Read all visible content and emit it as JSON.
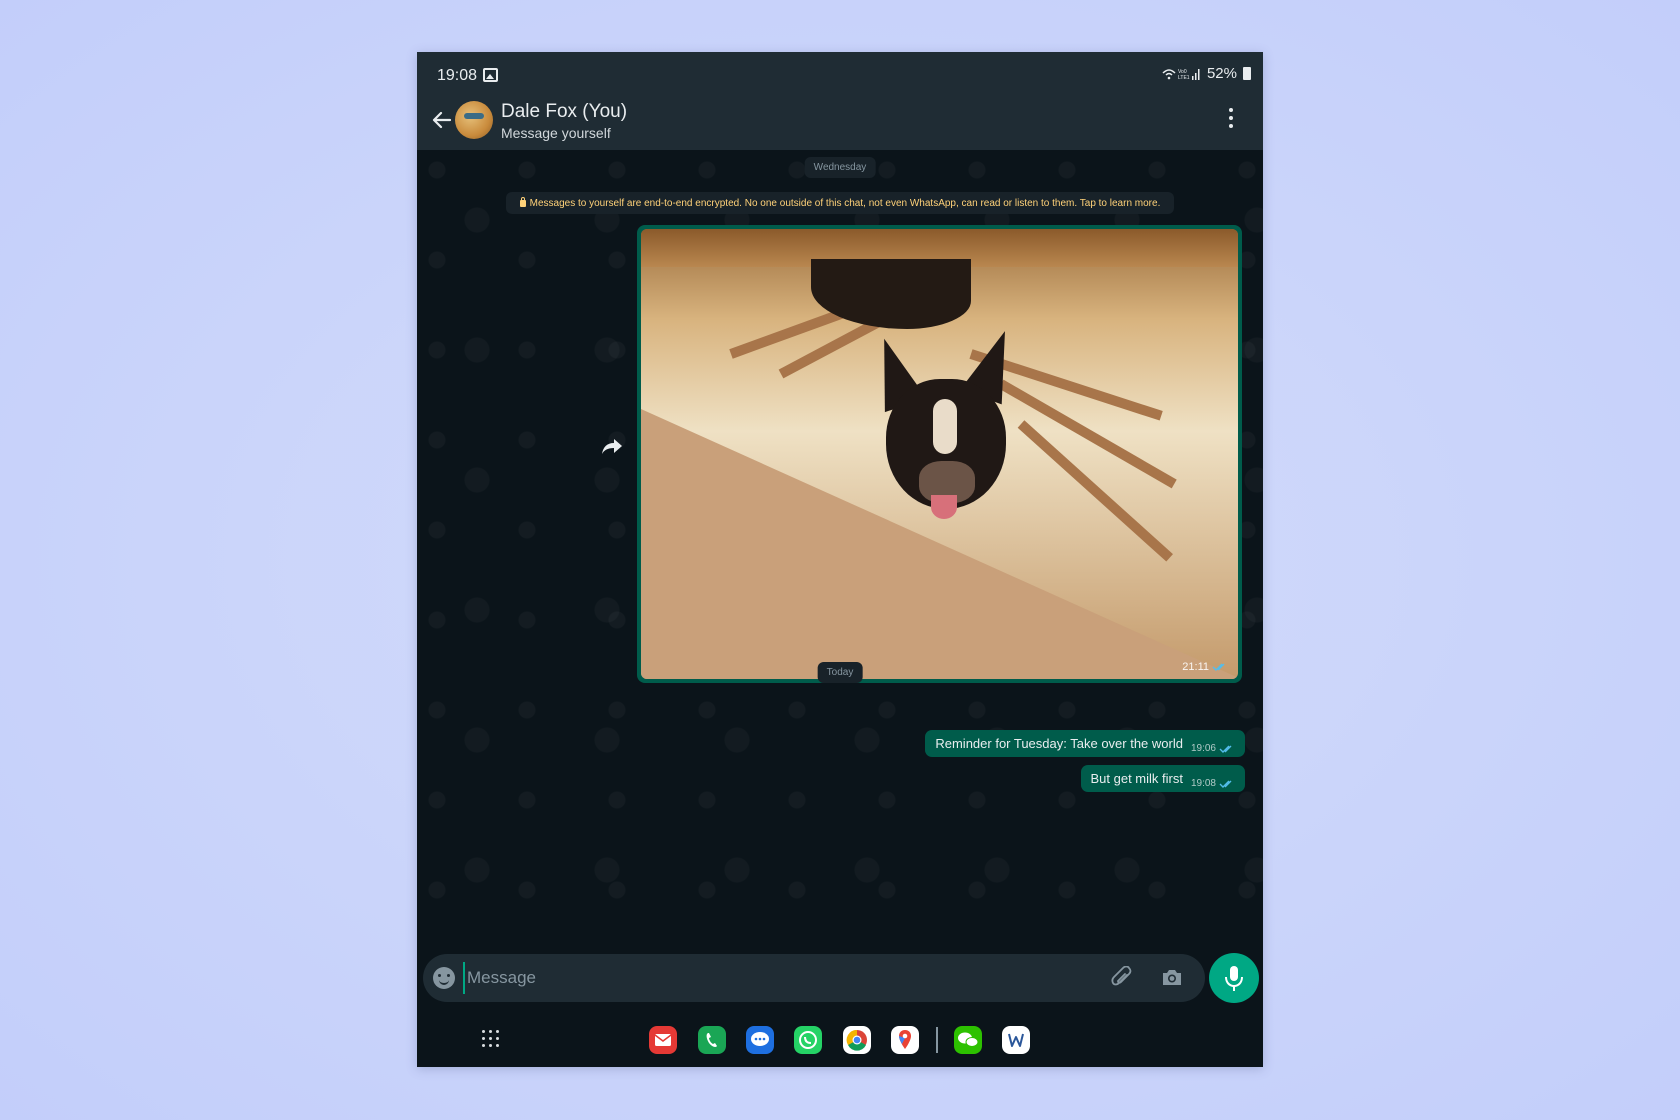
{
  "status": {
    "time": "19:08",
    "battery": "52%"
  },
  "header": {
    "name": "Dale Fox (You)",
    "subtitle": "Message yourself"
  },
  "chat": {
    "date_chip_1": "Wednesday",
    "encryption_notice": "Messages to yourself are end-to-end encrypted. No one outside of this chat, not even WhatsApp, can read or listen to them. Tap to learn more.",
    "photo_time": "21:11",
    "date_chip_2": "Today",
    "messages": [
      {
        "text": "Reminder for Tuesday: Take over the world",
        "time": "19:06"
      },
      {
        "text": "But get milk first",
        "time": "19:08"
      }
    ]
  },
  "composer": {
    "placeholder": "Message"
  },
  "dock": {
    "apps": [
      "email-app-icon",
      "phone-app-icon",
      "messages-app-icon",
      "whatsapp-app-icon",
      "chrome-app-icon",
      "maps-app-icon",
      "wechat-app-icon",
      "word-app-icon"
    ]
  },
  "colors": {
    "accent": "#00a884",
    "outgoing_bubble": "#005c4b",
    "header": "#1f2c34",
    "background": "#0b141a",
    "ticks": "#53bdeb"
  }
}
